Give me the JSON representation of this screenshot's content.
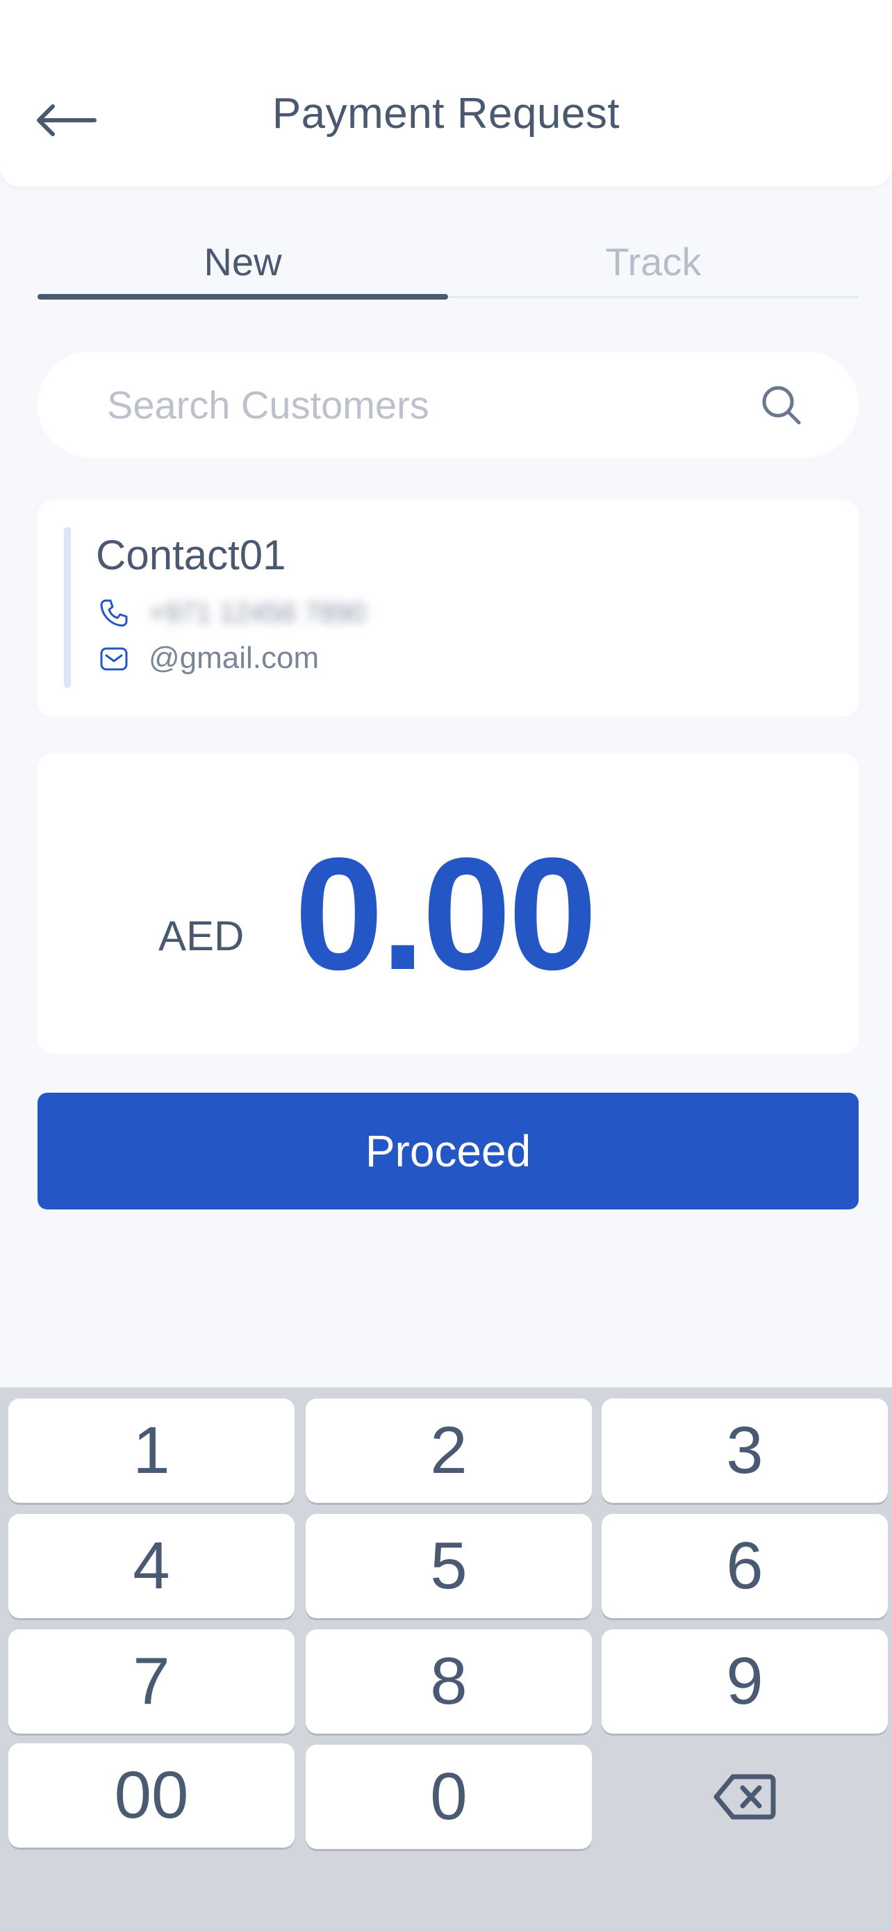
{
  "header": {
    "title": "Payment Request",
    "back_icon": "arrow-left-icon"
  },
  "tabs": [
    {
      "label": "New",
      "active": true
    },
    {
      "label": "Track",
      "active": false
    }
  ],
  "search": {
    "placeholder": "Search Customers",
    "value": "",
    "icon": "search-icon"
  },
  "contact": {
    "name": "Contact01",
    "phone": "+971 12456 7890",
    "email": "@gmail.com"
  },
  "amount": {
    "currency": "AED",
    "value": "0.00"
  },
  "proceed_label": "Proceed",
  "keypad": {
    "keys": [
      "1",
      "2",
      "3",
      "4",
      "5",
      "6",
      "7",
      "8",
      "9",
      "00",
      "0"
    ],
    "backspace_icon": "backspace-icon"
  },
  "colors": {
    "accent": "#2457c5",
    "text": "#4a5870",
    "muted": "#b7bdc8",
    "background": "#f7f8fc",
    "keypad_bg": "#d2d6dc"
  }
}
